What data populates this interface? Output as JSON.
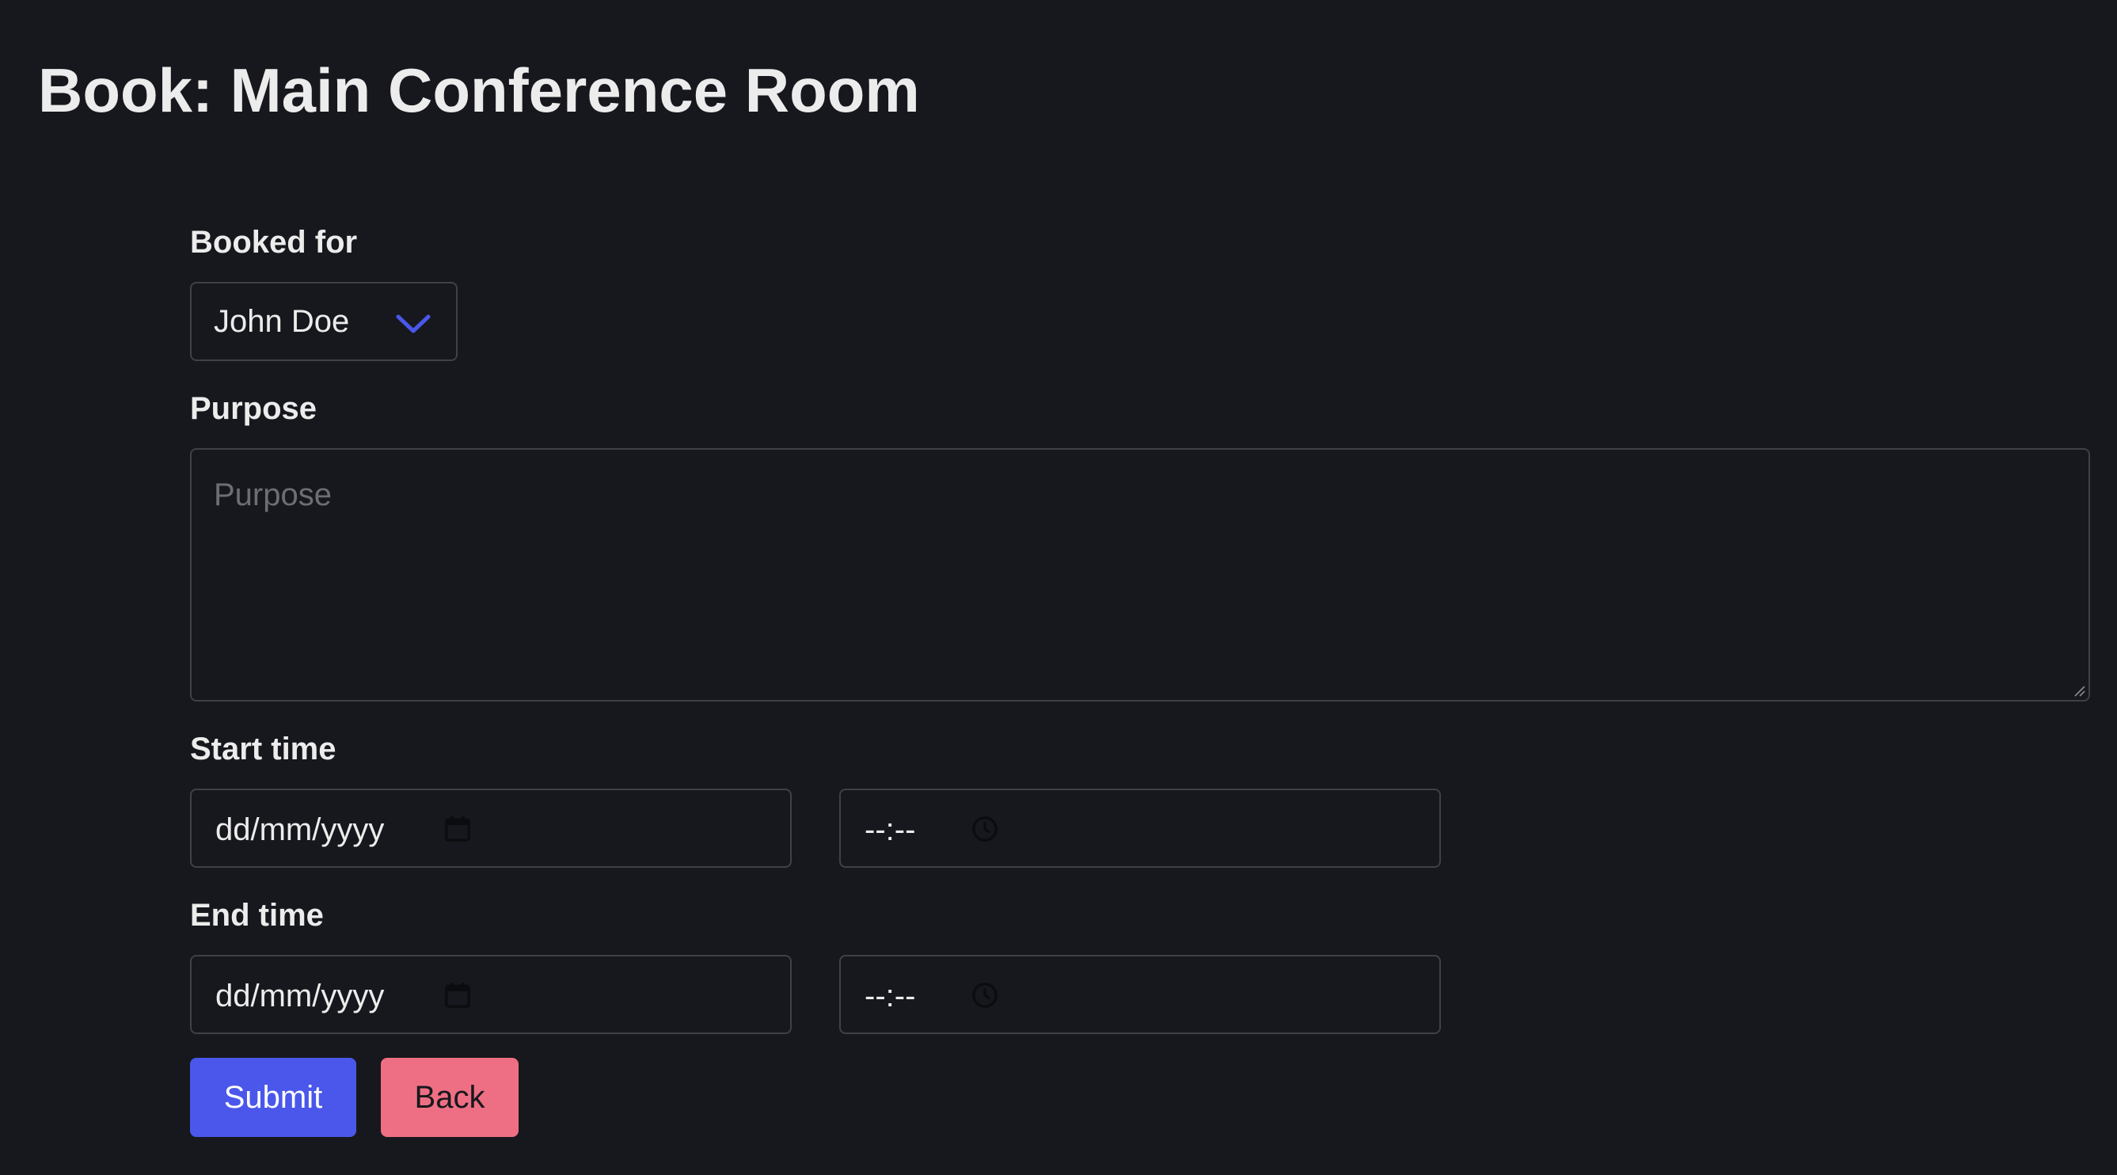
{
  "page": {
    "title": "Book: Main Conference Room"
  },
  "form": {
    "booked_for": {
      "label": "Booked for",
      "selected": "John Doe",
      "icon": "chevron-down-icon"
    },
    "purpose": {
      "label": "Purpose",
      "value": "",
      "placeholder": "Purpose"
    },
    "start_time": {
      "label": "Start time",
      "date_value": "dd/mm/yyyy",
      "time_value": "--:--"
    },
    "end_time": {
      "label": "End time",
      "date_value": "dd/mm/yyyy",
      "time_value": "--:--"
    },
    "buttons": {
      "submit_label": "Submit",
      "back_label": "Back"
    }
  },
  "icons": {
    "date": "calendar-icon",
    "time": "clock-icon",
    "select": "chevron-down-icon"
  },
  "colors": {
    "background": "#17181d",
    "text": "#ececec",
    "border": "#3f4148",
    "accent": "#4a57ea",
    "submit_button": "#4a57ea",
    "back_button": "#ee6f84",
    "placeholder": "#6c6e75"
  }
}
